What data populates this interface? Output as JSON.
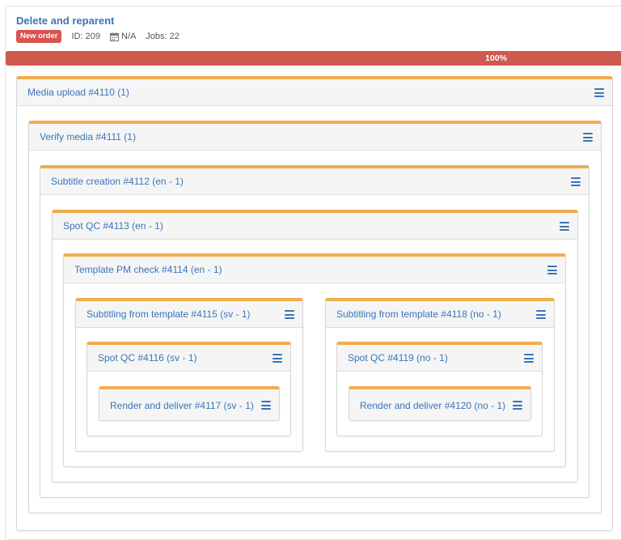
{
  "order": {
    "title": "Delete and reparent",
    "status_badge": "New order",
    "id_text": "ID: 209",
    "date_text": "N/A",
    "jobs_text": "Jobs: 22",
    "calendar_icon": "calendar-icon"
  },
  "progress": {
    "label": "100%",
    "value": 100,
    "color": "#d0594f"
  },
  "colors": {
    "accent_top": "#f0ad4e",
    "link": "#3a74b8",
    "badge": "#d9534f"
  },
  "jobs": {
    "j4110": "Media upload #4110 (1)",
    "j4111": "Verify media #4111 (1)",
    "j4112": "Subtitle creation #4112 (en - 1)",
    "j4113": "Spot QC #4113 (en - 1)",
    "j4114": "Template PM check #4114 (en - 1)",
    "j4115": "Subtitling from template #4115 (sv - 1)",
    "j4118": "Subtitling from template #4118 (no - 1)",
    "j4116": "Spot QC #4116 (sv - 1)",
    "j4119": "Spot QC #4119 (no - 1)",
    "j4117": "Render and deliver #4117 (sv - 1)",
    "j4120": "Render and deliver #4120 (no - 1)"
  },
  "menu_icon": "hamburger-menu-icon"
}
